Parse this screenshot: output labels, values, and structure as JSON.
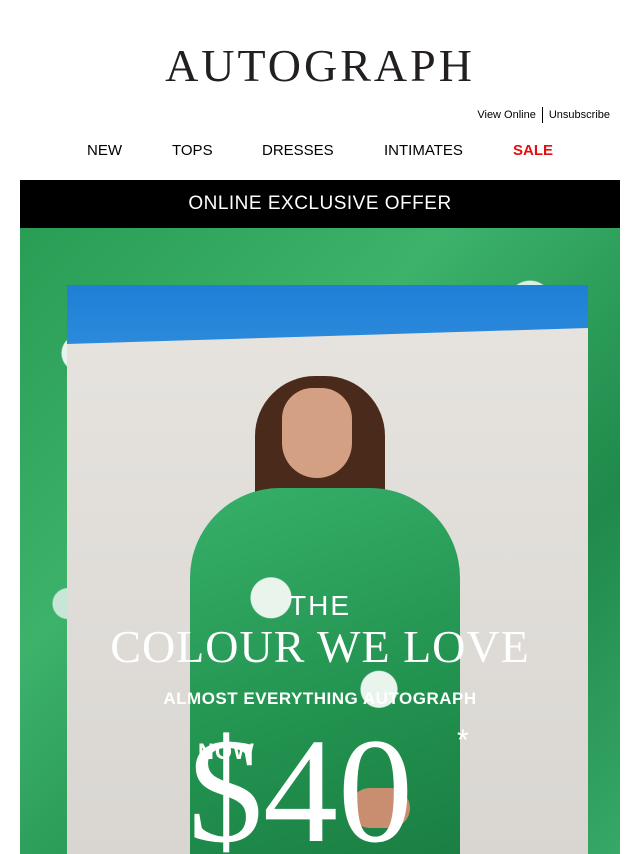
{
  "brand": {
    "logo_text": "AUTOGRAPH"
  },
  "utility_links": {
    "view_online": "View Online",
    "unsubscribe": "Unsubscribe"
  },
  "nav": {
    "items": [
      {
        "label": "NEW"
      },
      {
        "label": "TOPS"
      },
      {
        "label": "DRESSES"
      },
      {
        "label": "INTIMATES"
      },
      {
        "label": "SALE",
        "color": "#e10f0f"
      }
    ]
  },
  "banner": {
    "text": "ONLINE EXCLUSIVE OFFER",
    "background": "#000000"
  },
  "hero": {
    "headline_small": "THE",
    "headline_large": "COLOUR WE LOVE",
    "subheadline": "ALMOST EVERYTHING AUTOGRAPH",
    "price_prefix": "NOW",
    "price": "$40",
    "asterisk": "*"
  }
}
